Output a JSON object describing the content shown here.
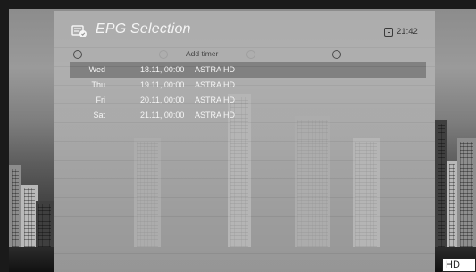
{
  "header": {
    "title": "EPG Selection",
    "time": "21:42",
    "icon": "epg-calendar-icon"
  },
  "color_keys": [
    {
      "label": ""
    },
    {
      "label": "Add timer"
    },
    {
      "label": ""
    },
    {
      "label": ""
    }
  ],
  "list": {
    "selected_index": 0,
    "rows": [
      {
        "day": "Wed",
        "datetime": "18.11, 00:00",
        "channel": "ASTRA HD"
      },
      {
        "day": "Thu",
        "datetime": "19.11, 00:00",
        "channel": "ASTRA HD"
      },
      {
        "day": "Fri",
        "datetime": "20.11, 00:00",
        "channel": "ASTRA HD"
      },
      {
        "day": "Sat",
        "datetime": "21.11, 00:00",
        "channel": "ASTRA HD"
      }
    ]
  },
  "badge": {
    "text": "HD"
  },
  "colors": {
    "panel": "#afafaf",
    "selected_row": "#7a7a7a",
    "text_light": "#f5f5f5"
  }
}
